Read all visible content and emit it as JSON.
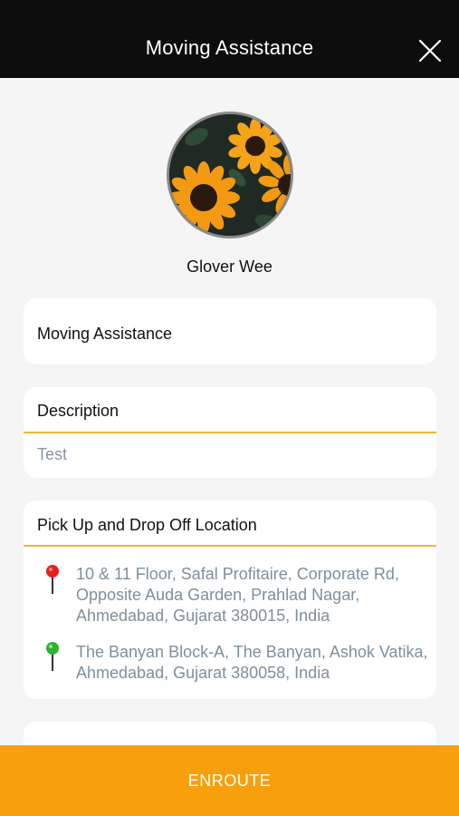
{
  "header": {
    "title": "Moving Assistance",
    "close_icon": "close-icon"
  },
  "profile": {
    "name": "Glover Wee",
    "avatar_icon": "sunflower-avatar"
  },
  "service": {
    "label": "Moving Assistance"
  },
  "description": {
    "label": "Description",
    "value": "Test"
  },
  "locations": {
    "label": "Pick Up and Drop Off Location",
    "pickup": {
      "address": "10 & 11 Floor, Safal Profitaire, Corporate Rd, Opposite Auda Garden, Prahlad Nagar, Ahmedabad, Gujarat 380015, India",
      "pin_color": "#e8201a"
    },
    "dropoff": {
      "address": "The Banyan Block-A, The Banyan, Ashok Vatika, Ahmedabad, Gujarat 380058, India",
      "pin_color": "#2cb52c"
    }
  },
  "footer": {
    "button_label": "ENROUTE"
  },
  "colors": {
    "accent": "#f7a00b",
    "divider": "#f2b53b",
    "header_bg": "#0d0d0d"
  }
}
